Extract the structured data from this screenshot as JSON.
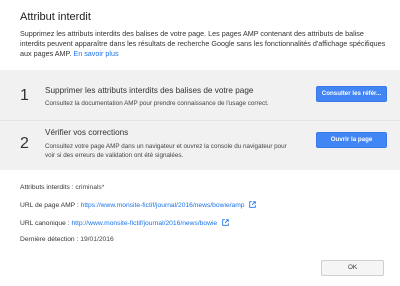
{
  "dialog": {
    "title": "Attribut interdit",
    "intro": "Supprimez les attributs interdits des balises de votre page. Les pages AMP contenant des attributs de balise interdits peuvent apparaître dans les résultats de recherche Google sans les fonctionnalités d'affichage spécifiques aux pages AMP.",
    "learn_more": "En savoir plus"
  },
  "steps": [
    {
      "number": "1",
      "title": "Supprimer les attributs interdits des balises de votre page",
      "description": "Consultez la documentation AMP pour prendre connaissance de l'usage correct.",
      "button": "Consulter les référ..."
    },
    {
      "number": "2",
      "title": "Vérifier vos corrections",
      "description": "Consultez votre page AMP dans un navigateur et ouvrez la console du navigateur pour voir si des erreurs de validation ont été signalées.",
      "button": "Ouvrir la page"
    }
  ],
  "details": {
    "forbidden_label": "Attributs interdits :",
    "forbidden_value": "criminals*",
    "amp_url_label": "URL de page AMP :",
    "amp_url_value": "https://www.monsite-fictif/journal/2016/news/bowie/amp",
    "canonical_label": "URL canonique :",
    "canonical_value": "http://www.monsite-fictif/journal/2016/news/bowie",
    "detected_label": "Dernière détection :",
    "detected_value": "19/01/2016"
  },
  "footer": {
    "ok": "OK"
  },
  "icons": {
    "external": "external-link-icon"
  },
  "colors": {
    "accent": "#4285f4",
    "link": "#1a73e8"
  }
}
